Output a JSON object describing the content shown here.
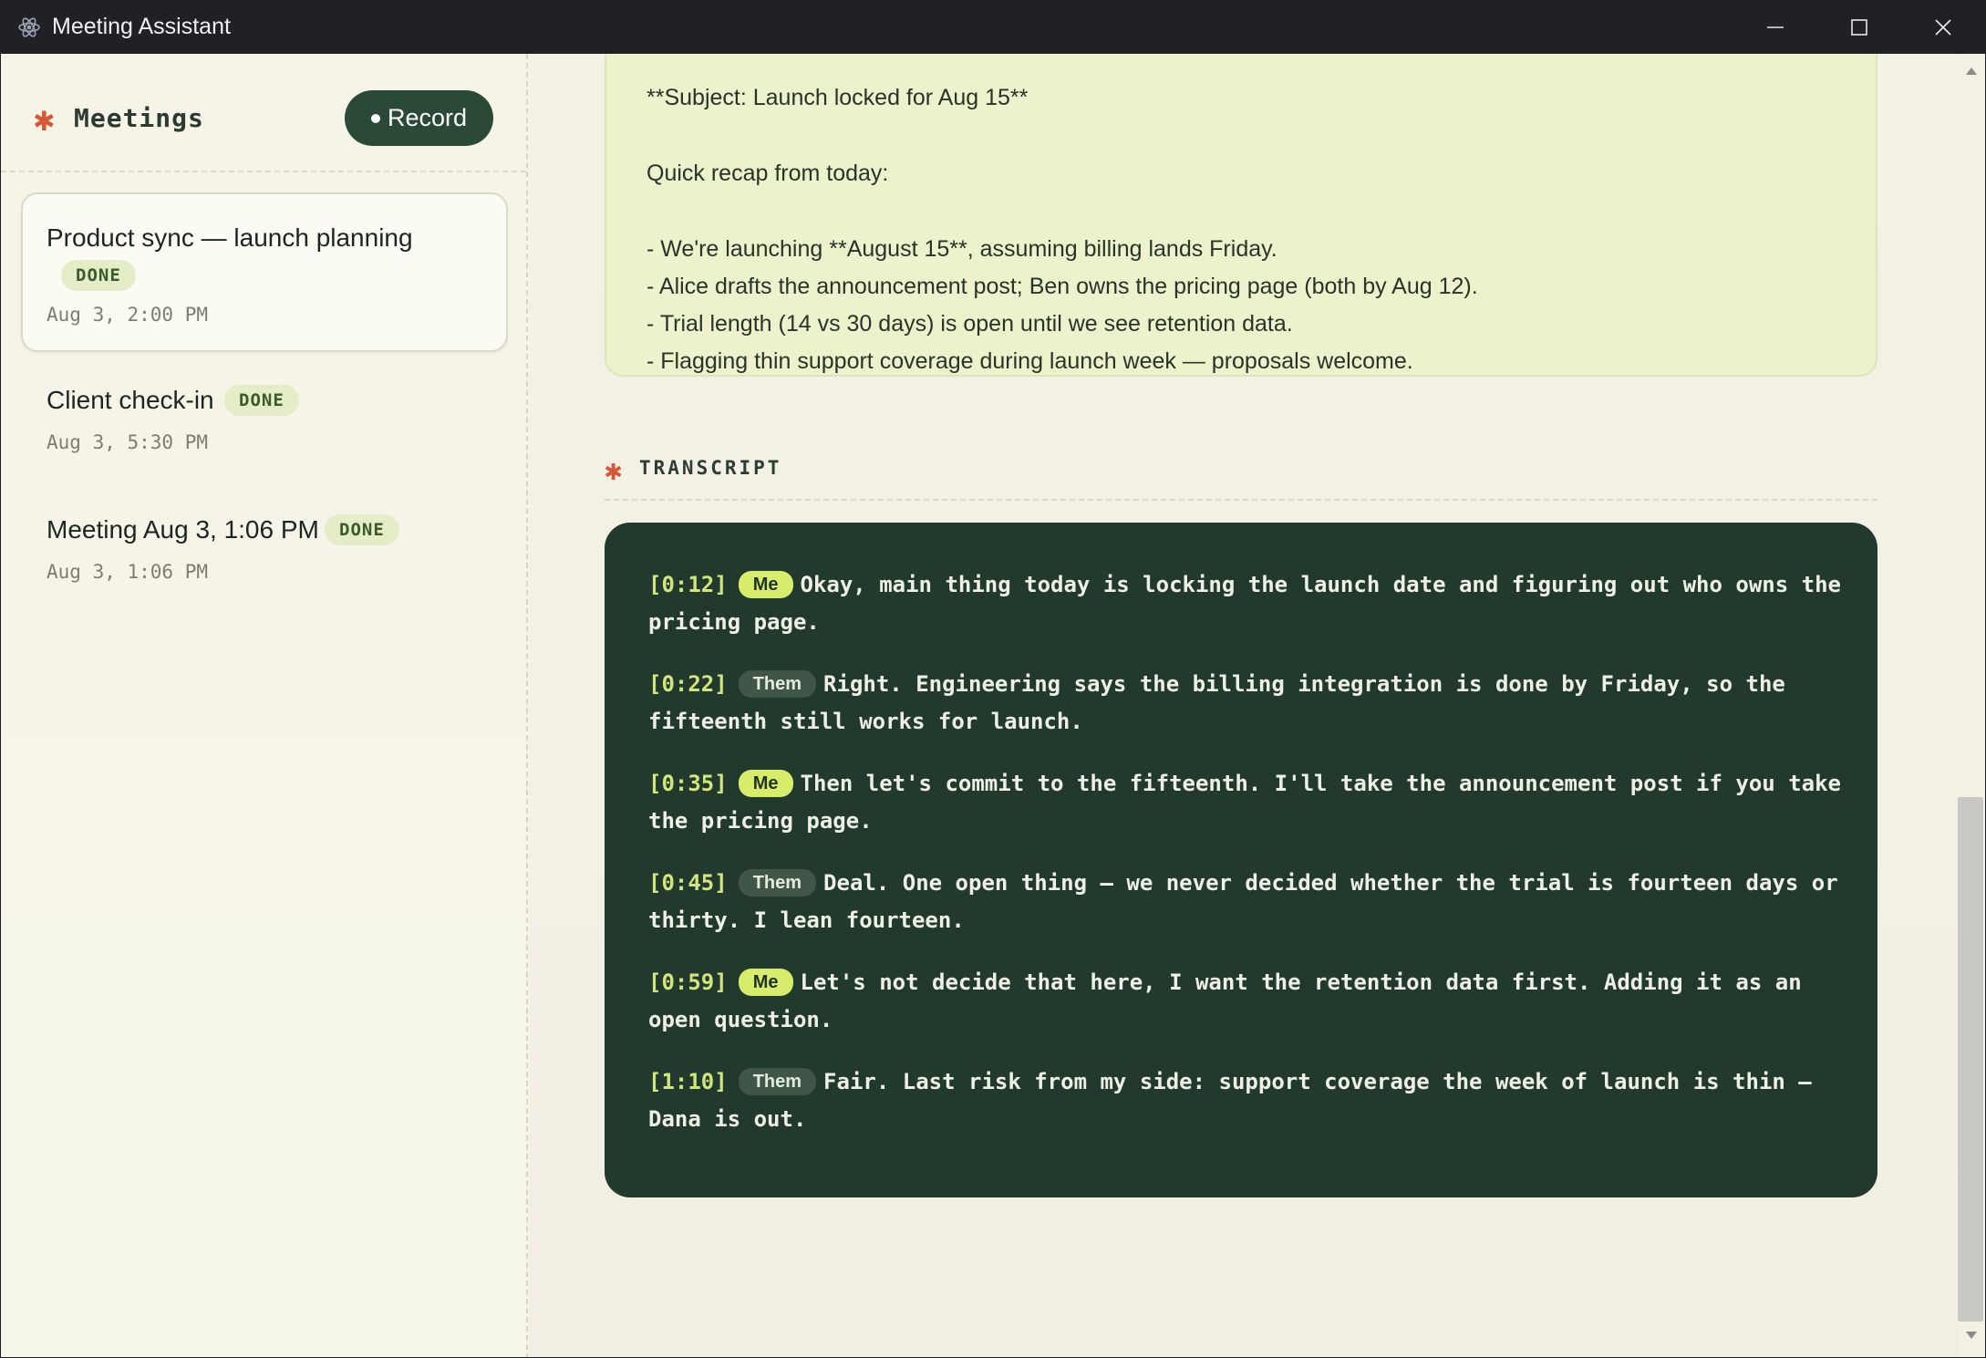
{
  "window": {
    "title": "Meeting Assistant",
    "icon": "electron-atom-icon"
  },
  "sidebar": {
    "heading": "Meetings",
    "heading_marker": "✱",
    "record_label": "Record",
    "meetings": [
      {
        "title": "Product sync — launch planning",
        "status": "DONE",
        "date": "Aug 3, 2:00 PM",
        "selected": true
      },
      {
        "title": "Client check-in",
        "status": "DONE",
        "date": "Aug 3, 5:30 PM",
        "selected": false
      },
      {
        "title": "Meeting Aug 3, 1:06 PM",
        "status": "DONE",
        "date": "Aug 3, 1:06 PM",
        "selected": false
      }
    ]
  },
  "summary": {
    "lines": [
      "**Subject: Launch locked for Aug 15**",
      "Quick recap from today:",
      "- We're launching **August 15**, assuming billing lands Friday.",
      "- Alice drafts the announcement post; Ben owns the pricing page (both by Aug 12).",
      "- Trial length (14 vs 30 days) is open until we see retention data.",
      "- Flagging thin support coverage during launch week — proposals welcome."
    ]
  },
  "transcript": {
    "heading": "TRANSCRIPT",
    "heading_marker": "✱",
    "entries": [
      {
        "time": "[0:12]",
        "speaker": "Me",
        "text": "Okay, main thing today is locking the launch date and figuring out who owns the pricing page."
      },
      {
        "time": "[0:22]",
        "speaker": "Them",
        "text": "Right. Engineering says the billing integration is done by Friday, so the fifteenth still works for launch."
      },
      {
        "time": "[0:35]",
        "speaker": "Me",
        "text": "Then let's commit to the fifteenth. I'll take the announcement post if you take the pricing page."
      },
      {
        "time": "[0:45]",
        "speaker": "Them",
        "text": "Deal. One open thing — we never decided whether the trial is fourteen days or thirty. I lean fourteen."
      },
      {
        "time": "[0:59]",
        "speaker": "Me",
        "text": "Let's not decide that here, I want the retention data first. Adding it as an open question."
      },
      {
        "time": "[1:10]",
        "speaker": "Them",
        "text": "Fair. Last risk from my side: support coverage the week of launch is thin — Dana is out."
      }
    ]
  },
  "colors": {
    "accent": "#d4573a",
    "record_button": "#2a4a37",
    "transcript_bg": "#213a2d",
    "summary_bg": "#ebf2cc",
    "badge_bg": "#e4ecc8",
    "timestamp": "#d2e57d",
    "me_pill": "#d6ec6a",
    "them_pill": "#3f5648"
  }
}
